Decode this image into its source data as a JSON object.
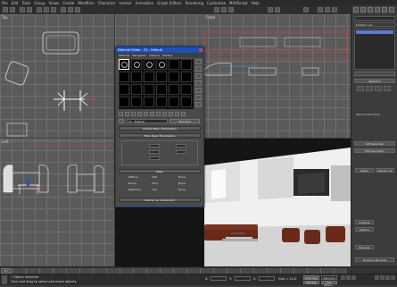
{
  "menu": [
    "File",
    "Edit",
    "Tools",
    "Group",
    "Views",
    "Create",
    "Modifiers",
    "Character",
    "reactor",
    "Animation",
    "Graph Editors",
    "Rendering",
    "Customize",
    "MAXScript",
    "Help"
  ],
  "right_panel": {
    "modifier_list": "Modifier List",
    "rollout_selection": "Selection",
    "named_selections": "Named Selections",
    "soft_selection": "Soft Selection",
    "edit_geometry": "Edit Geometry",
    "attach": "Attach",
    "attach_list": "Attach List",
    "collapse": "Collapse",
    "detach": "Detach",
    "explode": "Explode",
    "preserve": "Preserve Normals"
  },
  "material_editor": {
    "title": "Material Editor - 01 - Default",
    "menu": [
      "Material",
      "Navigation",
      "Options",
      "Utilities"
    ],
    "material_name": "01 - Default",
    "shader_type": "Standard",
    "rollouts": {
      "shader_basic": "Shader Basic Parameters",
      "blinn_basic": "Blinn Basic Parameters",
      "maps": "Maps",
      "mental_ray": "mental ray Connection"
    },
    "params": [
      {
        "label": "Diffuse",
        "value": "100"
      },
      {
        "label": "Bump",
        "value": "30.0"
      },
      {
        "label": "Reflection",
        "value": "100"
      }
    ],
    "none_label": "None"
  },
  "viewports": {
    "top": "Top",
    "front": "Front",
    "left": "Left",
    "perspective": "Perspective"
  },
  "timeline": {
    "position": "0 / 100"
  },
  "status": {
    "selected": "1 Object Selected",
    "prompt": "Click and drag to select and move objects",
    "x_label": "X:",
    "y_label": "Y:",
    "z_label": "Z:",
    "grid": "Grid = 10.0",
    "autokey": "Auto Key",
    "setkey": "Set Key",
    "selected_dd": "Selected",
    "key_filters": "Key Filters..."
  },
  "colors": {
    "title_blue": "#1c4fc0",
    "viewport_gray": "#5a5a5a",
    "selection_red": "#d04040"
  }
}
